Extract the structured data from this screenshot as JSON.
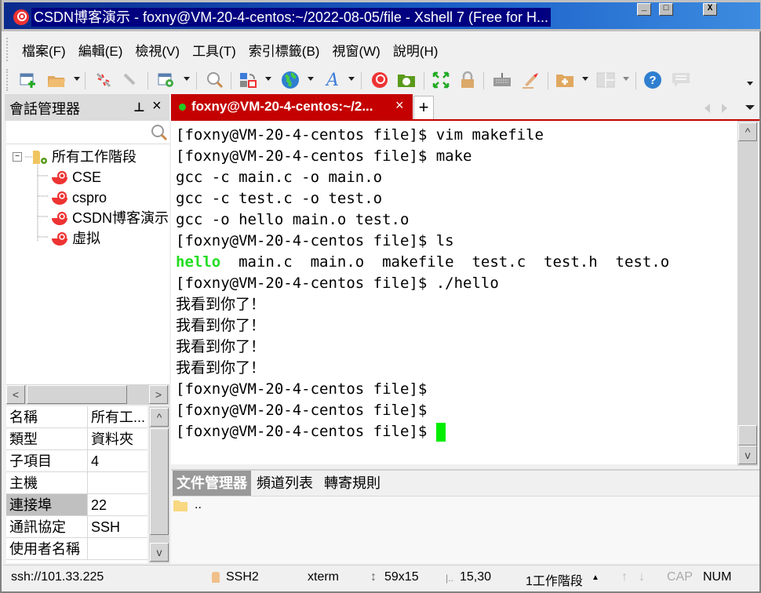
{
  "window": {
    "title": "CSDN博客演示 - foxny@VM-20-4-centos:~/2022-08-05/file - Xshell 7 (Free for H...",
    "controls": {
      "minimize": "_",
      "maximize": "□",
      "close": "X"
    }
  },
  "menu": {
    "items": [
      "檔案(F)",
      "編輯(E)",
      "檢視(V)",
      "工具(T)",
      "索引標籤(B)",
      "視窗(W)",
      "說明(H)"
    ]
  },
  "toolbar": {
    "icons": [
      "new-session-icon",
      "open-folder-icon",
      "disconnect-icon",
      "reconnect-icon",
      "session-properties-icon",
      "find-icon",
      "transfer-icon",
      "globe-icon",
      "font-icon",
      "xshell-icon",
      "xftp-icon",
      "fullscreen-icon",
      "lock-icon",
      "keyboard-icon",
      "highlight-icon",
      "new-folder-icon",
      "layout-icon",
      "help-icon",
      "chat-icon"
    ]
  },
  "session_manager": {
    "title": "會話管理器",
    "pin": "⊥",
    "close": "×",
    "search_placeholder": "",
    "tree": {
      "root": "所有工作階段",
      "children": [
        "CSE",
        "cspro",
        "CSDN博客演示",
        "虛拟"
      ]
    },
    "properties": [
      {
        "key": "名稱",
        "value": "所有工..."
      },
      {
        "key": "類型",
        "value": "資料夾"
      },
      {
        "key": "子項目",
        "value": "4"
      },
      {
        "key": "主機",
        "value": ""
      },
      {
        "key": "連接埠",
        "value": "22"
      },
      {
        "key": "通訊協定",
        "value": "SSH"
      },
      {
        "key": "使用者名稱",
        "value": ""
      }
    ]
  },
  "tabs": {
    "active": {
      "label": "foxny@VM-20-4-centos:~/2...",
      "status_color": "#22cc22"
    },
    "close": "×",
    "add": "+"
  },
  "terminal": {
    "lines": [
      "[foxny@VM-20-4-centos file]$ vim makefile",
      "[foxny@VM-20-4-centos file]$ make",
      "gcc -c main.c -o main.o",
      "gcc -c test.c -o test.o",
      "gcc -o hello main.o test.o",
      "[foxny@VM-20-4-centos file]$ ls"
    ],
    "ls_output": {
      "exec": "hello",
      "rest": "  main.c  main.o  makefile  test.c  test.h  test.o"
    },
    "run_line": "[foxny@VM-20-4-centos file]$ ./hello",
    "output_lines": [
      "我看到你了！",
      "我看到你了！",
      "我看到你了！",
      "我看到你了！"
    ],
    "prompt_lines": [
      "[foxny@VM-20-4-centos file]$",
      "[foxny@VM-20-4-centos file]$"
    ],
    "final_prompt": "[foxny@VM-20-4-centos file]$ "
  },
  "bottom_panel": {
    "tabs": [
      "文件管理器",
      "頻道列表",
      "轉寄規則"
    ],
    "active_tab": 0,
    "files": [
      ".."
    ]
  },
  "statusbar": {
    "address": "ssh://101.33.225",
    "protocol": "SSH2",
    "terminal_type": "xterm",
    "size": "59x15",
    "cursor_pos": "15,30",
    "sessions": "1工作階段",
    "cap": "CAP",
    "num": "NUM"
  }
}
